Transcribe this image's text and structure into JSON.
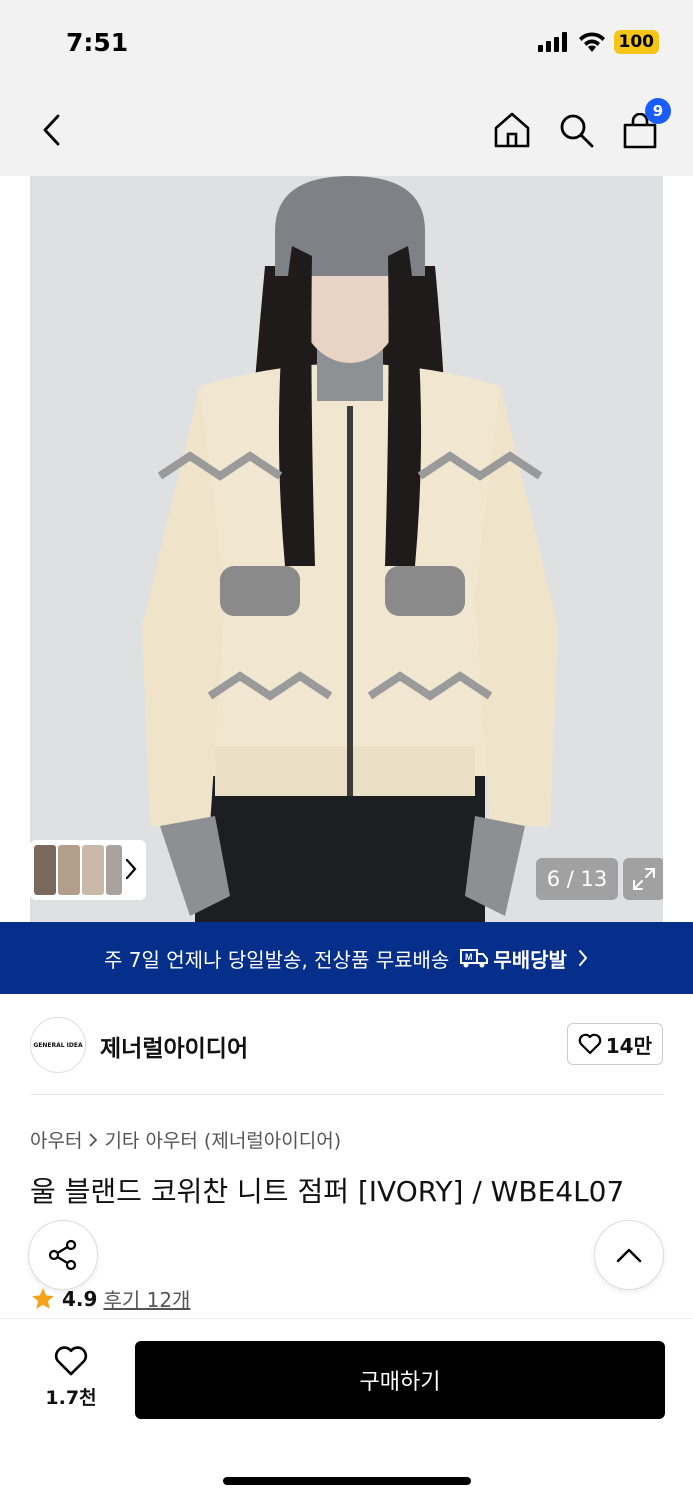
{
  "status": {
    "time": "7:51",
    "battery": "100"
  },
  "nav": {
    "cart_count": "9"
  },
  "gallery": {
    "counter": "6 / 13"
  },
  "delivery": {
    "text": "주 7일 언제나 당일발송, 전상품 무료배송",
    "brand": "무배당발"
  },
  "brand": {
    "logo_text": "GENERAL IDEA",
    "name": "제너럴아이디어",
    "likes": "14만"
  },
  "breadcrumb": {
    "category": "아우터",
    "subcategory": "기타 아우터 (제너럴아이디어)"
  },
  "product": {
    "title": "울 블랜드 코위찬 니트 점퍼 [IVORY] / WBE4L07"
  },
  "rating": {
    "score": "4.9",
    "reviews": "후기 12개"
  },
  "bottom": {
    "wish_count": "1.7천",
    "buy_label": "구매하기"
  },
  "colors": {
    "banner": "#052f8a",
    "badge": "#1a5cff",
    "battery": "#f5c518"
  }
}
